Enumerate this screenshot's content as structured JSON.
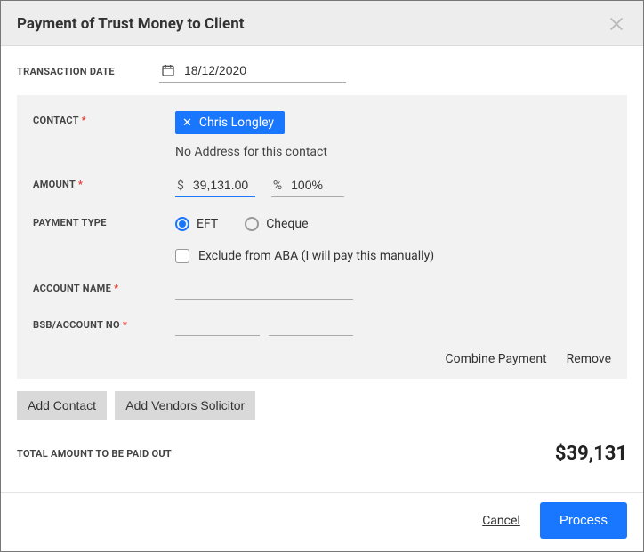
{
  "header": {
    "title": "Payment of Trust Money to Client"
  },
  "labels": {
    "transaction_date": "TRANSACTION DATE",
    "contact": "CONTACT",
    "amount": "AMOUNT",
    "payment_type": "PAYMENT TYPE",
    "account_name": "ACCOUNT NAME",
    "bsb_account_no": "BSB/ACCOUNT NO",
    "total": "TOTAL AMOUNT TO BE PAID OUT"
  },
  "transaction": {
    "date": "18/12/2020"
  },
  "contact": {
    "chip_name": "Chris Longley",
    "address_note": "No Address for this contact"
  },
  "amount": {
    "currency_symbol": "$",
    "value": "39,131.00",
    "percent_symbol": "%",
    "percent_value": "100%"
  },
  "payment_type": {
    "eft": "EFT",
    "cheque": "Cheque",
    "exclude_label": "Exclude from ABA (I will pay this manually)"
  },
  "account": {
    "name": "",
    "bsb": "",
    "acct": ""
  },
  "links": {
    "combine": "Combine Payment",
    "remove": "Remove"
  },
  "buttons": {
    "add_contact": "Add Contact",
    "add_vendors_solicitor": "Add Vendors Solicitor",
    "cancel": "Cancel",
    "process": "Process"
  },
  "total": {
    "value": "$39,131"
  }
}
